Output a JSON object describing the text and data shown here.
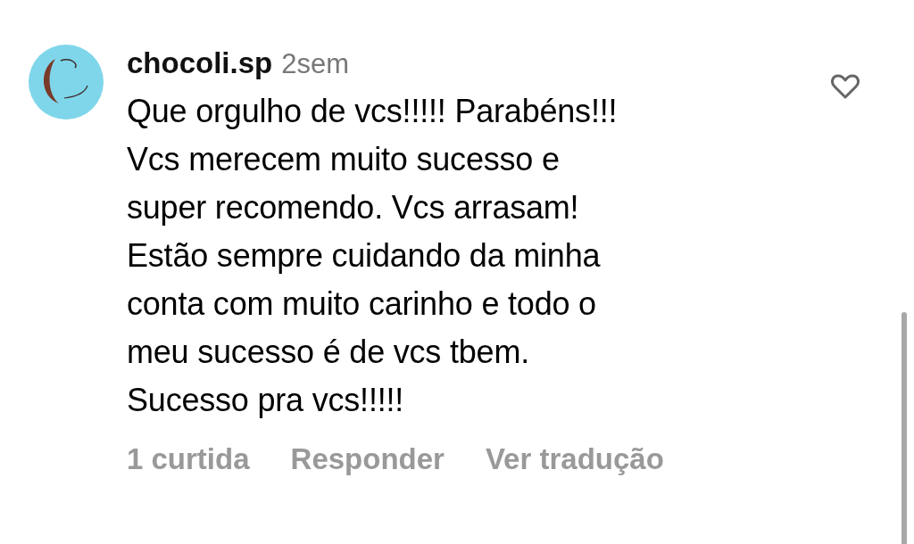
{
  "comment": {
    "username": "chocoli.sp",
    "time": "2sem",
    "text": "Que orgulho de vcs!!!!! Parabéns!!!\nVcs merecem muito sucesso e\nsuper recomendo. Vcs arrasam!\nEstão sempre cuidando da minha\nconta com muito carinho e todo o\nmeu sucesso é de vcs tbem.\nSucesso pra vcs!!!!!",
    "liked": false,
    "actions": [
      "1 curtida",
      "Responder",
      "Ver tradução"
    ]
  }
}
